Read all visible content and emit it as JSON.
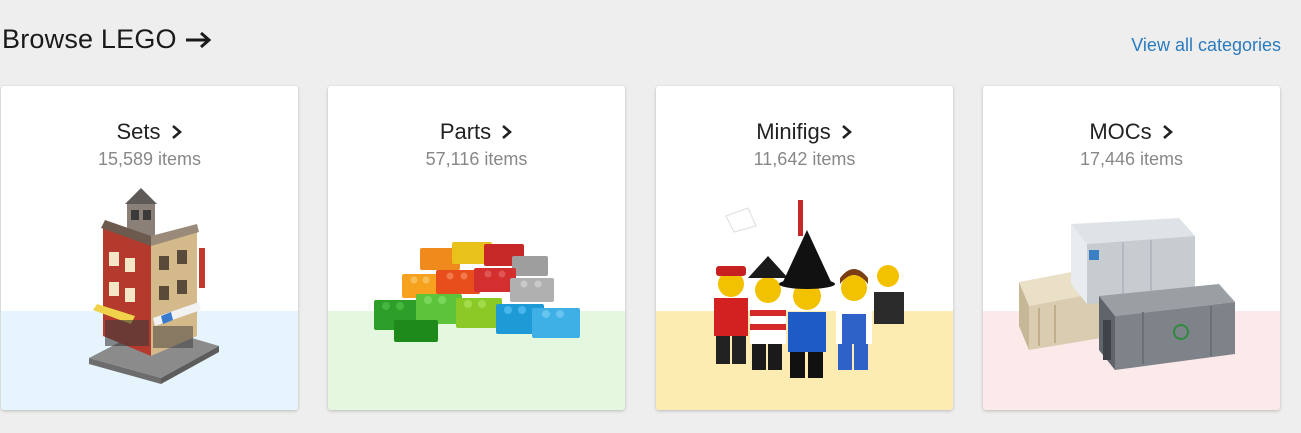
{
  "header": {
    "title": "Browse LEGO",
    "view_all_label": "View all categories"
  },
  "colors": {
    "link": "#2b7bbf",
    "sets_band": "#e6f4fd",
    "parts_band": "#e3f8df",
    "minifigs_band": "#fcecb2",
    "mocs_band": "#fce9e9"
  },
  "cards": [
    {
      "title": "Sets",
      "count": "15,589 items",
      "image": "lego-building-icon"
    },
    {
      "title": "Parts",
      "count": "57,116 items",
      "image": "lego-bricks-pile-icon"
    },
    {
      "title": "Minifigs",
      "count": "11,642 items",
      "image": "minifigures-group-icon"
    },
    {
      "title": "MOCs",
      "count": "17,446 items",
      "image": "shipping-containers-icon"
    }
  ]
}
